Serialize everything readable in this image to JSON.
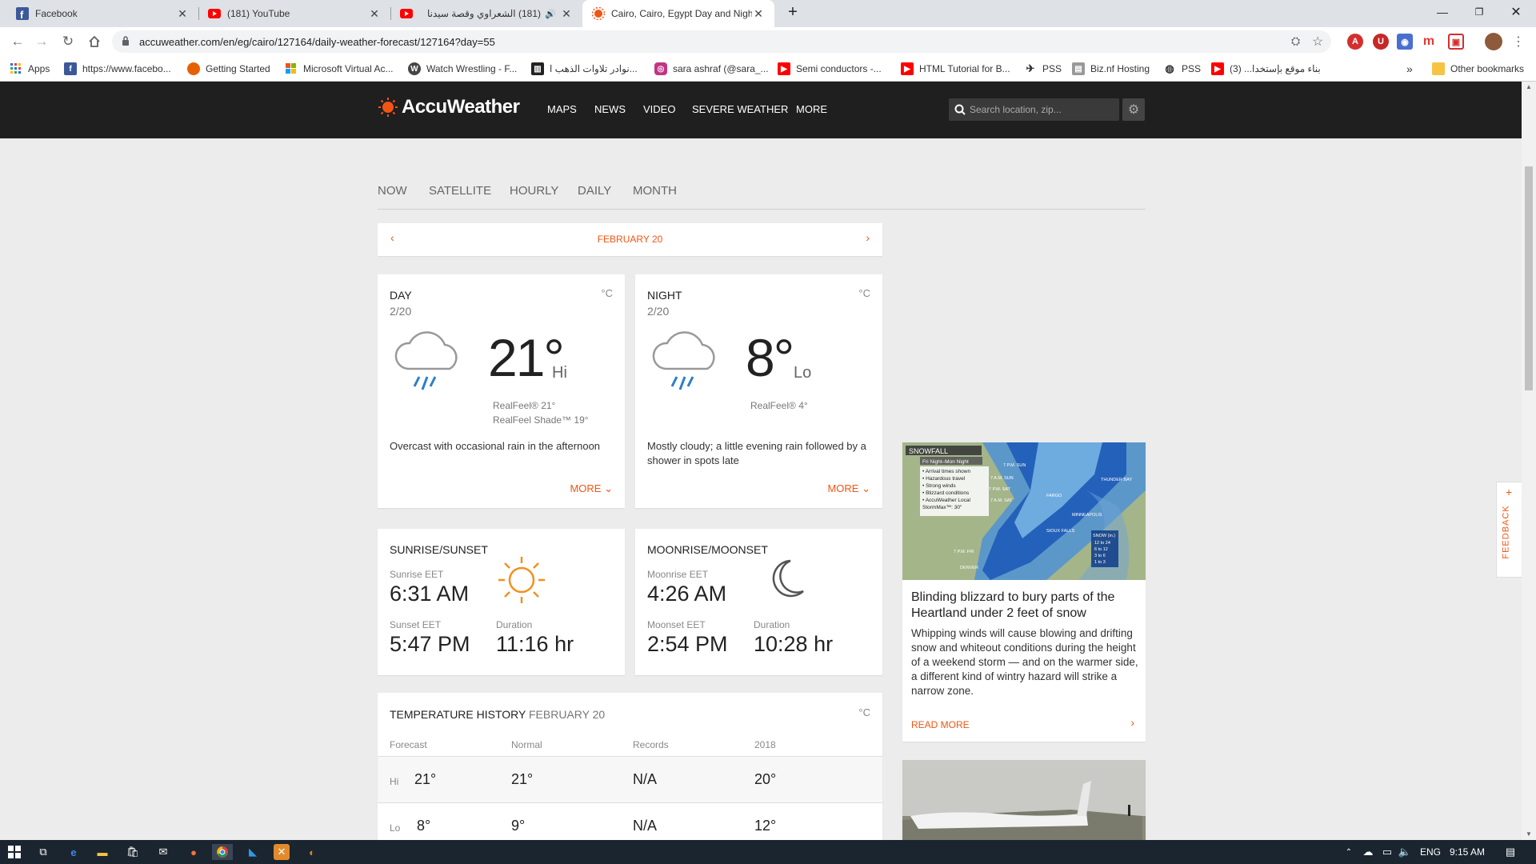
{
  "browser": {
    "tabs": [
      {
        "title": "Facebook",
        "icon": "facebook-icon",
        "active": false
      },
      {
        "title": "(181) YouTube",
        "icon": "youtube-icon",
        "active": false
      },
      {
        "title": "(181) الشعراوي وقصة سيدنا",
        "icon": "youtube-icon",
        "active": false
      },
      {
        "title": "Cairo, Cairo, Egypt Day and Nigh",
        "icon": "accuweather-icon",
        "active": true
      }
    ],
    "new_tab": "+",
    "url": "accuweather.com/en/eg/cairo/127164/daily-weather-forecast/127164?day=55",
    "bookmarks": [
      {
        "label": "Apps",
        "icon": "apps-grid-icon"
      },
      {
        "label": "https://www.facebo...",
        "icon": "facebook-icon"
      },
      {
        "label": "Getting Started",
        "icon": "firefox-icon"
      },
      {
        "label": "Microsoft Virtual Ac...",
        "icon": "microsoft-icon"
      },
      {
        "label": "Watch Wrestling - F...",
        "icon": "wordpress-icon"
      },
      {
        "label": "نوادر تلاوات الذهب ا...",
        "icon": "library-icon"
      },
      {
        "label": "sara ashraf (@sara_...",
        "icon": "instagram-icon"
      },
      {
        "label": "Semi conductors -...",
        "icon": "youtube-icon"
      },
      {
        "label": "HTML Tutorial for B...",
        "icon": "youtube-icon"
      },
      {
        "label": "PSS",
        "icon": "plane-icon"
      },
      {
        "label": "Biz.nf Hosting",
        "icon": "hosting-icon"
      },
      {
        "label": "PSS",
        "icon": "globe-icon"
      },
      {
        "label": "بناء موقع بإستخدا... (3)",
        "icon": "youtube-icon"
      }
    ],
    "bookmarks_overflow": "»",
    "other_bookmarks": "Other bookmarks"
  },
  "site": {
    "logo": "AccuWeather",
    "nav": [
      "MAPS",
      "NEWS",
      "VIDEO",
      "SEVERE WEATHER",
      "MORE"
    ],
    "search_placeholder": "Search location, zip...",
    "subnav": [
      "NOW",
      "SATELLITE",
      "HOURLY",
      "DAILY",
      "MONTH"
    ],
    "date_label": "FEBRUARY 20",
    "day": {
      "title": "DAY",
      "date": "2/20",
      "unit": "°C",
      "temp": "21°",
      "hilo": "Hi",
      "realfeel": "RealFeel® 21°",
      "realfeel_shade": "RealFeel Shade™ 19°",
      "description": "Overcast with occasional rain in the afternoon",
      "more": "MORE"
    },
    "night": {
      "title": "NIGHT",
      "date": "2/20",
      "unit": "°C",
      "temp": "8°",
      "hilo": "Lo",
      "realfeel": "RealFeel® 4°",
      "description": "Mostly cloudy; a little evening rain followed by a shower in spots late",
      "more": "MORE"
    },
    "sun": {
      "title": "SUNRISE/SUNSET",
      "rise_label": "Sunrise EET",
      "rise": "6:31 AM",
      "set_label": "Sunset EET",
      "set": "5:47 PM",
      "duration_label": "Duration",
      "duration": "11:16 hr"
    },
    "moon": {
      "title": "MOONRISE/MOONSET",
      "rise_label": "Moonrise EET",
      "rise": "4:26 AM",
      "set_label": "Moonset EET",
      "set": "2:54 PM",
      "duration_label": "Duration",
      "duration": "10:28 hr"
    },
    "history": {
      "title": "TEMPERATURE HISTORY",
      "date": "FEBRUARY 20",
      "unit": "°C",
      "columns": [
        "Forecast",
        "Normal",
        "Records",
        "2018"
      ],
      "hi_label": "Hi",
      "hi": [
        "21°",
        "21°",
        "N/A",
        "20°"
      ],
      "lo_label": "Lo",
      "lo": [
        "8°",
        "9°",
        "N/A",
        "12°"
      ]
    },
    "news": {
      "map_title": "SNOWFALL",
      "map_subtitle": "Fri Night–Mon Night",
      "map_legend": [
        "• Arrival times shown",
        "• Hazardous travel",
        "• Strong winds",
        "• Blizzard conditions",
        "• AccuWeather Local",
        "  StormMax™: 30\""
      ],
      "map_cities": [
        "THUNDER BAY",
        "FARGO",
        "MINNEAPOLIS",
        "SIOUX FALLS",
        "DENVER"
      ],
      "map_times": [
        "7 P.M. SUN",
        "7 A.M. SUN",
        "7 P.M. SAT",
        "7 A.M. SAT",
        "7 P.M. FRI"
      ],
      "map_snow_title": "SNOW (in.)",
      "map_snow_ranges": [
        "12 to 24",
        "6 to 12",
        "3 to 6",
        "1 to 3"
      ],
      "headline": "Blinding blizzard to bury parts of the Heartland under 2 feet of snow",
      "body": "Whipping winds will cause blowing and drifting snow and whiteout conditions during the height of a weekend storm — and on the warmer side, a different kind of wintry hazard will strike a narrow zone.",
      "read_more": "READ MORE"
    },
    "feedback": "FEEDBACK"
  },
  "taskbar": {
    "language": "ENG",
    "time": "9:15 AM"
  },
  "colors": {
    "accent": "#f05514",
    "header_bg": "#1f1f1f",
    "page_bg": "#ececec"
  }
}
